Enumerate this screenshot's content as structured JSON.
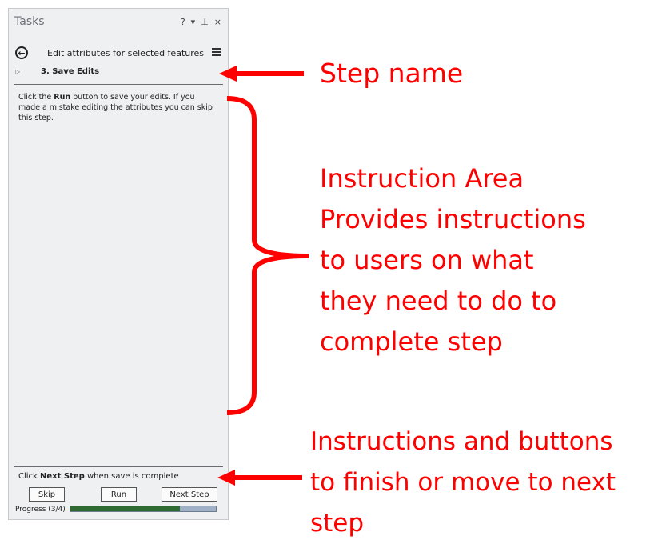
{
  "pane": {
    "title": "Tasks",
    "help_glyph": "?",
    "dropdown_glyph": "▾",
    "pin_glyph": "⊥",
    "close_glyph": "×",
    "back_glyph": "←",
    "task_name": "Edit attributes for selected features",
    "expand_glyph": "▷",
    "step_name": "3.  Save Edits",
    "instruction_prefix": "Click the ",
    "instruction_bold": "Run",
    "instruction_suffix": " button to save your edits. If you made a mistake editing the attributes you can skip this step.",
    "footer_prefix": "Click ",
    "footer_bold": "Next Step",
    "footer_suffix": " when save is complete",
    "skip_label": "Skip",
    "run_label": "Run",
    "next_label": "Next Step",
    "progress_label": "Progress (3/4)",
    "progress_fraction": 0.75
  },
  "annotations": {
    "step_name": "Step name",
    "instruction_area_lines": [
      "Instruction Area",
      "Provides instructions",
      "to users on what",
      "they need to do to",
      "complete step"
    ],
    "finish_lines": [
      "Instructions and buttons",
      "to finish or move to next",
      "step"
    ]
  },
  "colors": {
    "annotation": "#ff0000",
    "progress_fill": "#2f6a33",
    "progress_track": "#9fb0c6"
  },
  "icons": [
    "help-icon",
    "dropdown-icon",
    "pin-icon",
    "close-icon",
    "back-arrow-icon",
    "menu-icon",
    "expand-icon",
    "arrow-icon",
    "bracket"
  ]
}
